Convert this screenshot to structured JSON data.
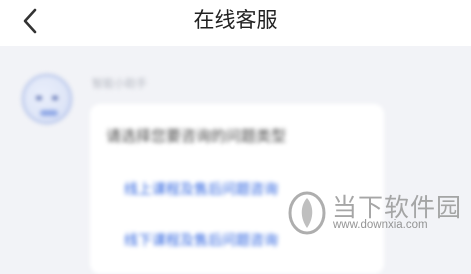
{
  "header": {
    "title": "在线客服",
    "back_icon": "chevron-left-icon"
  },
  "chat": {
    "sender": "智能小助手",
    "bubble": {
      "question": "请选择您要咨询的问题类型",
      "options": [
        {
          "label": "线上课程及售后问题咨询"
        },
        {
          "label": "线下课程及售后问题咨询"
        }
      ]
    }
  },
  "watermark": {
    "brand": "当下软件园",
    "url": "www.downxia.com"
  },
  "colors": {
    "link": "#2d63e0",
    "background": "#f2f3f7",
    "bubble": "#ffffff"
  }
}
